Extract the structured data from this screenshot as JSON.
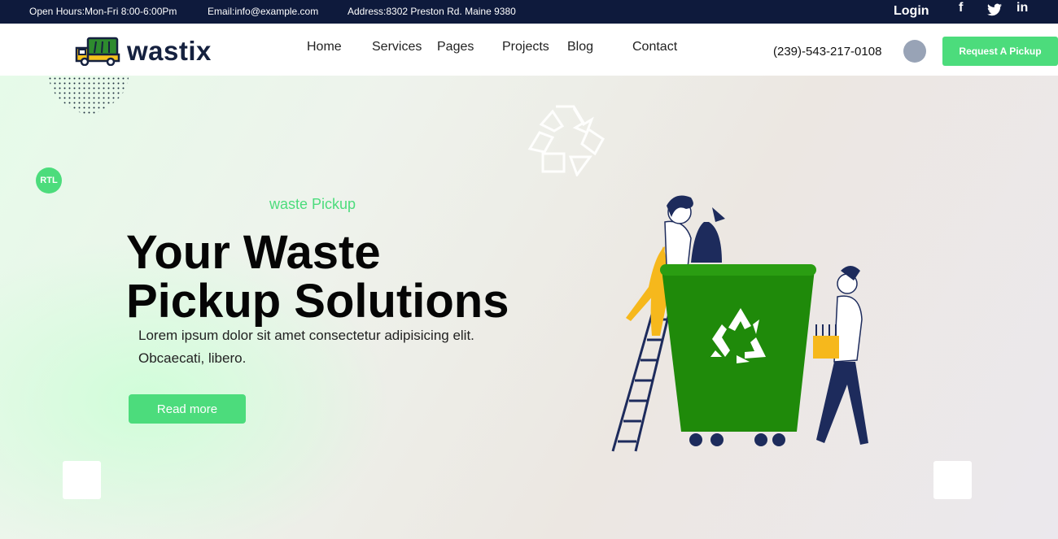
{
  "topbar": {
    "hours": "Open Hours:Mon-Fri 8:00-6:00Pm",
    "email": "Email:info@example.com",
    "address": "Address:8302 Preston Rd. Maine 9380",
    "login": "Login",
    "social": [
      "f",
      "t",
      "in"
    ]
  },
  "brand": {
    "name": "wastix"
  },
  "nav": {
    "links": [
      "Home",
      "Services",
      "Pages",
      "Projects",
      "Blog",
      "Contact"
    ],
    "phone": "(239)-543-217-0108",
    "cta": "Request A Pickup"
  },
  "hero": {
    "rtl": "RTL",
    "subtitle": "waste Pickup",
    "headline_line1": "Your Waste",
    "headline_line2": "Pickup Solutions",
    "desc_line1": "Lorem ipsum dolor sit amet consectetur adipisicing elit.",
    "desc_line2": "Obcaecati, libero.",
    "button": "Read more"
  },
  "colors": {
    "accent": "#4cdc7c",
    "topbar": "#0e1a3c",
    "bin": "#1f8a0a"
  },
  "icons": [
    "facebook-icon",
    "twitter-icon",
    "linkedin-icon",
    "recycle-icon",
    "truck-icon"
  ]
}
